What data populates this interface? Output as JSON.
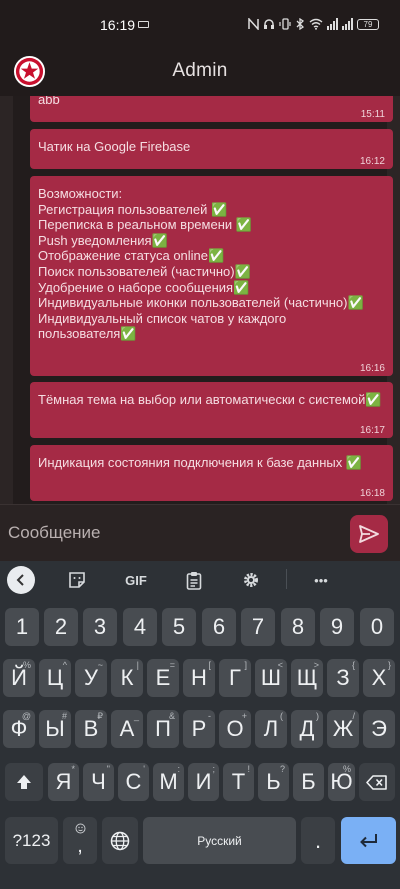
{
  "status_bar": {
    "time": "16:19",
    "battery": "79"
  },
  "app_bar": {
    "title": "Admin"
  },
  "messages": [
    {
      "text": "abb",
      "time": "15:11"
    },
    {
      "text": "Чатик на Google Firebase",
      "time": "16:12"
    },
    {
      "text": "Возможности:\nРегистрация пользователей ✅\nПереписка в реальном времени ✅\nPush уведомления✅\nОтображение статуса online✅\nПоиск пользователей (частично)✅\nУдобрение о наборе сообщения✅\nИндивидуальные иконки пользователей (частично)✅\nИндивидуальный список чатов у каждого пользователя✅",
      "time": "16:16"
    },
    {
      "text": "Тёмная тема на выбор или автоматически с системой✅",
      "time": "16:17"
    },
    {
      "text": "Индикация состояния подключения к базе данных ✅",
      "time": "16:18"
    }
  ],
  "input": {
    "placeholder": "Сообщение"
  },
  "keyboard": {
    "toolbar": {
      "gif": "GIF",
      "more": "•••"
    },
    "rows": [
      [
        {
          "label": "1"
        },
        {
          "label": "2"
        },
        {
          "label": "3"
        },
        {
          "label": "4"
        },
        {
          "label": "5"
        },
        {
          "label": "6"
        },
        {
          "label": "7"
        },
        {
          "label": "8"
        },
        {
          "label": "9"
        },
        {
          "label": "0"
        }
      ],
      [
        {
          "label": "Й",
          "hint": "%"
        },
        {
          "label": "Ц",
          "hint": "^"
        },
        {
          "label": "У",
          "hint": "~"
        },
        {
          "label": "К",
          "hint": "|"
        },
        {
          "label": "Е",
          "hint": "="
        },
        {
          "label": "Н",
          "hint": "["
        },
        {
          "label": "Г",
          "hint": "]"
        },
        {
          "label": "Ш",
          "hint": "<"
        },
        {
          "label": "Щ",
          "hint": ">"
        },
        {
          "label": "З",
          "hint": "{"
        },
        {
          "label": "Х",
          "hint": "}"
        }
      ],
      [
        {
          "label": "Ф",
          "hint": "@"
        },
        {
          "label": "Ы",
          "hint": "#"
        },
        {
          "label": "В",
          "hint": "₽"
        },
        {
          "label": "А",
          "hint": "_"
        },
        {
          "label": "П",
          "hint": "&"
        },
        {
          "label": "Р",
          "hint": "-"
        },
        {
          "label": "О",
          "hint": "+"
        },
        {
          "label": "Л",
          "hint": "("
        },
        {
          "label": "Д",
          "hint": ")"
        },
        {
          "label": "Ж",
          "hint": "/"
        },
        {
          "label": "Э"
        }
      ],
      [
        {
          "label": "Я",
          "hint": "*"
        },
        {
          "label": "Ч",
          "hint": "\""
        },
        {
          "label": "С",
          "hint": "'"
        },
        {
          "label": "М",
          "hint": ":"
        },
        {
          "label": "И",
          "hint": ";"
        },
        {
          "label": "Т",
          "hint": "!"
        },
        {
          "label": "Ь",
          "hint": "?"
        },
        {
          "label": "Б"
        },
        {
          "label": "Ю",
          "hint": "%"
        }
      ]
    ],
    "sym_key": "?123",
    "comma": ",",
    "space": "Русский",
    "period": "."
  }
}
